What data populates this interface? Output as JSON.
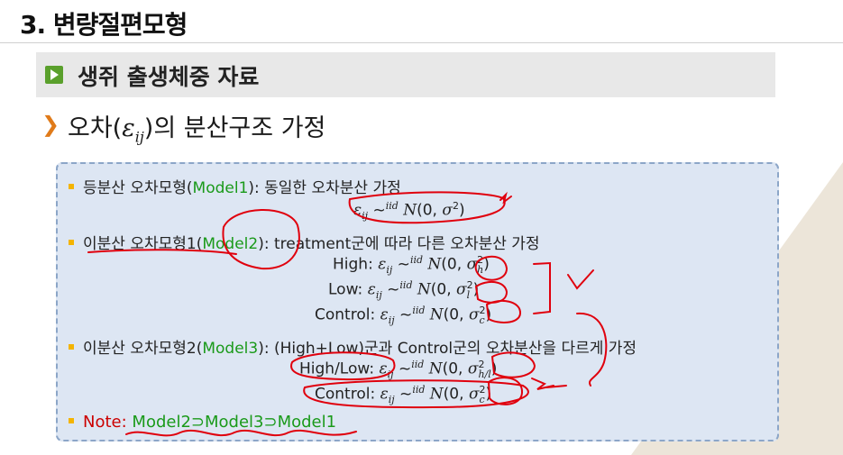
{
  "slide_title": "3. 변량절편모형",
  "section_title": "생쥐 출생체중 자료",
  "topic": {
    "prefix": "오차(",
    "symbol": "ε",
    "subscript": "ij",
    "suffix": ")의 분산구조 가정"
  },
  "bullets": [
    {
      "pre": "등분산 오차모형(",
      "model": "Model1",
      "post": "): 동일한 오차분산 가정"
    },
    {
      "pre": "이분산 오차모형1(",
      "model": "Model2",
      "post": "): treatment군에 따라 다른 오차분산 가정"
    },
    {
      "pre": "이분산 오차모형2(",
      "model": "Model3",
      "post": "): (High+Low)군과 Control군의 오차분산을 다르게 가정"
    }
  ],
  "equations": {
    "model1": {
      "label": ""
    },
    "high": {
      "label": "High:",
      "group": "h"
    },
    "low": {
      "label": "Low:",
      "group": "l"
    },
    "control": {
      "label": "Control:",
      "group": "c"
    },
    "highlow": {
      "label": "High/Low:",
      "group": "h/l"
    },
    "control2": {
      "label": "Control:",
      "group": "c"
    }
  },
  "note": {
    "label": "Note:",
    "relation": "Model2⊃Model3⊃Model1"
  },
  "colors": {
    "accent_green": "#1a9a1a",
    "note_red": "#cc0000",
    "bullet_gold": "#f4b400",
    "box_fill": "#dde6f3",
    "ink_red": "#e0000d"
  }
}
